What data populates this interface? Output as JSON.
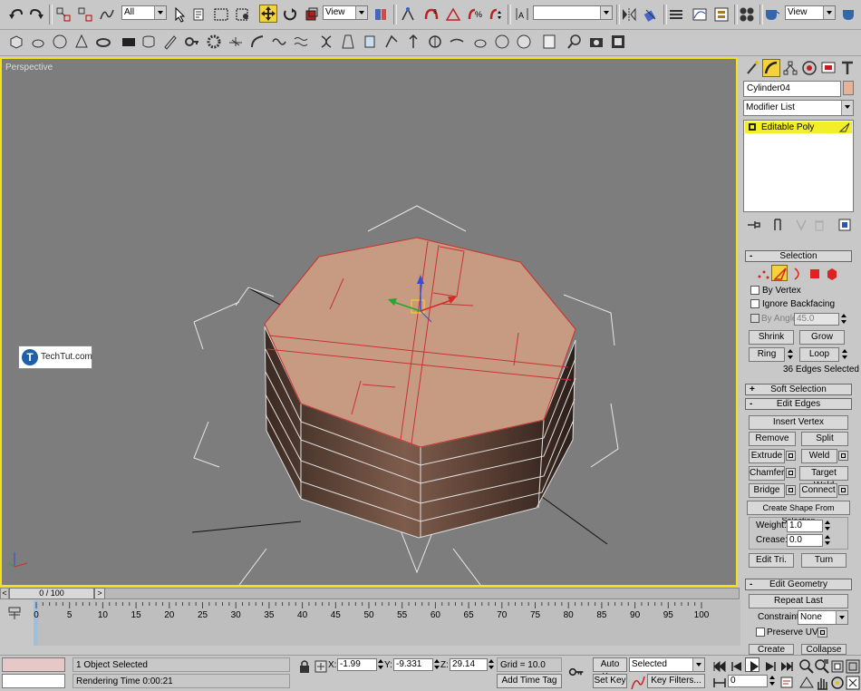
{
  "toolbar1": {
    "filter_value": "All",
    "refcoord_value": "View",
    "named_selection_value": "",
    "render_view_value": "View"
  },
  "viewport": {
    "label": "Perspective",
    "watermark": "TechTut.com",
    "watermark_t": "T"
  },
  "command_panel": {
    "object_name": "Cylinder04",
    "object_color": "#e5b398",
    "modifier_list_label": "Modifier List",
    "stack_item": "Editable Poly",
    "selection_rollout": "Selection",
    "by_vertex": "By Vertex",
    "ignore_backfacing": "Ignore Backfacing",
    "by_angle": "By Angle:",
    "by_angle_value": "45.0",
    "shrink": "Shrink",
    "grow": "Grow",
    "ring": "Ring",
    "loop": "Loop",
    "selection_status": "36 Edges Selected",
    "soft_selection_rollout": "Soft Selection",
    "edit_edges_rollout": "Edit Edges",
    "insert_vertex": "Insert Vertex",
    "remove": "Remove",
    "split": "Split",
    "extrude": "Extrude",
    "weld": "Weld",
    "chamfer": "Chamfer",
    "target_weld": "Target Weld",
    "bridge": "Bridge",
    "connect": "Connect",
    "create_shape": "Create Shape From Selection",
    "weight_label": "Weight:",
    "weight_value": "1.0",
    "crease_label": "Crease:",
    "crease_value": "0.0",
    "edit_tri": "Edit Tri.",
    "turn": "Turn",
    "edit_geometry_rollout": "Edit Geometry",
    "repeat_last": "Repeat Last",
    "constraints_label": "Constraints:",
    "constraints_value": "None",
    "preserve_uvs": "Preserve UVs",
    "create": "Create",
    "collapse": "Collapse",
    "plus_sign": "+",
    "minus_sign": "-"
  },
  "timeline": {
    "slider_label": "0 / 100",
    "prev_arrow": "<",
    "next_arrow": ">",
    "ticks": [
      "0",
      "5",
      "10",
      "15",
      "20",
      "25",
      "30",
      "35",
      "40",
      "45",
      "50",
      "55",
      "60",
      "65",
      "70",
      "75",
      "80",
      "85",
      "90",
      "95",
      "100"
    ]
  },
  "status": {
    "objects_selected": "1 Object Selected",
    "rendering_time": "Rendering Time  0:00:21",
    "x_label": "X:",
    "x_value": "-1.99",
    "y_label": "Y:",
    "y_value": "-9.331",
    "z_label": "Z:",
    "z_value": "29.14",
    "grid": "Grid = 10.0",
    "add_time_tag": "Add Time Tag",
    "auto_key": "Auto Key",
    "set_key": "Set Key",
    "key_mode_value": "Selected",
    "key_filters": "Key Filters...",
    "frame_value": "0"
  }
}
